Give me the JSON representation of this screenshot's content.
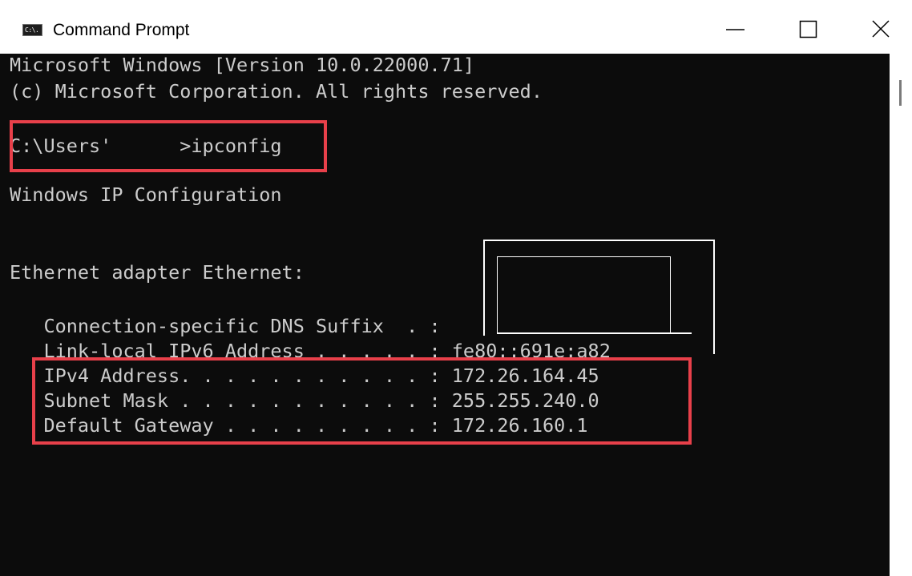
{
  "window": {
    "title": "Command Prompt",
    "app_icon_label": "C:\\."
  },
  "controls": {
    "minimize": "minimize",
    "maximize": "maximize",
    "close": "close"
  },
  "console": {
    "lines": [
      "Microsoft Windows [Version 10.0.22000.71]",
      "(c) Microsoft Corporation. All rights reserved.",
      "C:\\Users'      >ipconfig",
      "Windows IP Configuration",
      "Ethernet adapter Ethernet:",
      "   Connection-specific DNS Suffix  . :",
      "   Link-local IPv6 Address . . . . . : fe80::691e:a82",
      "   IPv4 Address. . . . . . . . . . . : 172.26.164.45",
      "   Subnet Mask . . . . . . . . . . . : 255.255.240.0",
      "   Default Gateway . . . . . . . . . : 172.26.160.1"
    ]
  },
  "colors": {
    "console_background": "#0c0c0c",
    "console_text": "#cccccc",
    "highlight": "#e8404a"
  }
}
